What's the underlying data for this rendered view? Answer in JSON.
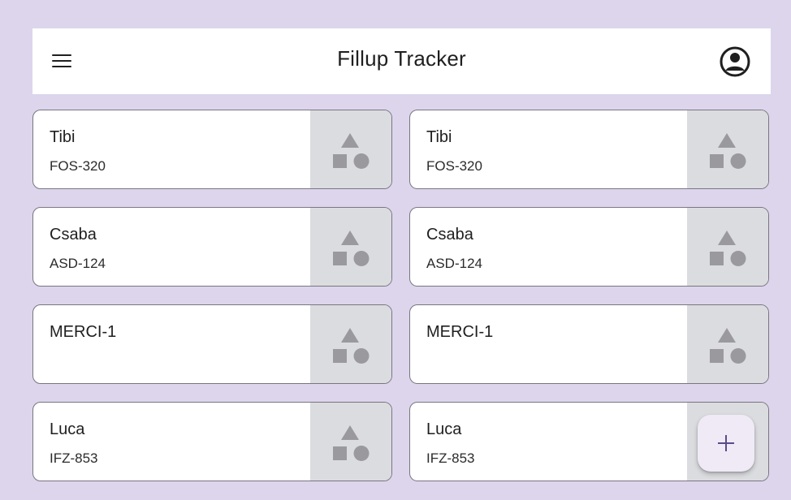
{
  "app_bar": {
    "title": "Fillup Tracker",
    "menu_icon": "menu-icon",
    "account_icon": "account-circle-icon"
  },
  "vehicles": [
    {
      "name": "Tibi",
      "plate": "FOS-320"
    },
    {
      "name": "Tibi",
      "plate": "FOS-320"
    },
    {
      "name": "Csaba",
      "plate": "ASD-124"
    },
    {
      "name": "Csaba",
      "plate": "ASD-124"
    },
    {
      "name": "MERCI-1",
      "plate": ""
    },
    {
      "name": "MERCI-1",
      "plate": ""
    },
    {
      "name": "Luca",
      "plate": "IFZ-853"
    },
    {
      "name": "Luca",
      "plate": "IFZ-853"
    }
  ],
  "thumbnail_icon": "shapes-placeholder-icon",
  "fab": {
    "icon": "plus-icon"
  },
  "colors": {
    "background": "#dcd5ec",
    "surface": "#ffffff",
    "thumbnail": "#dbdcdf",
    "placeholder_shape": "#9a9a9e",
    "fab_background": "#efeaf6",
    "fab_icon": "#5b4a8b"
  }
}
